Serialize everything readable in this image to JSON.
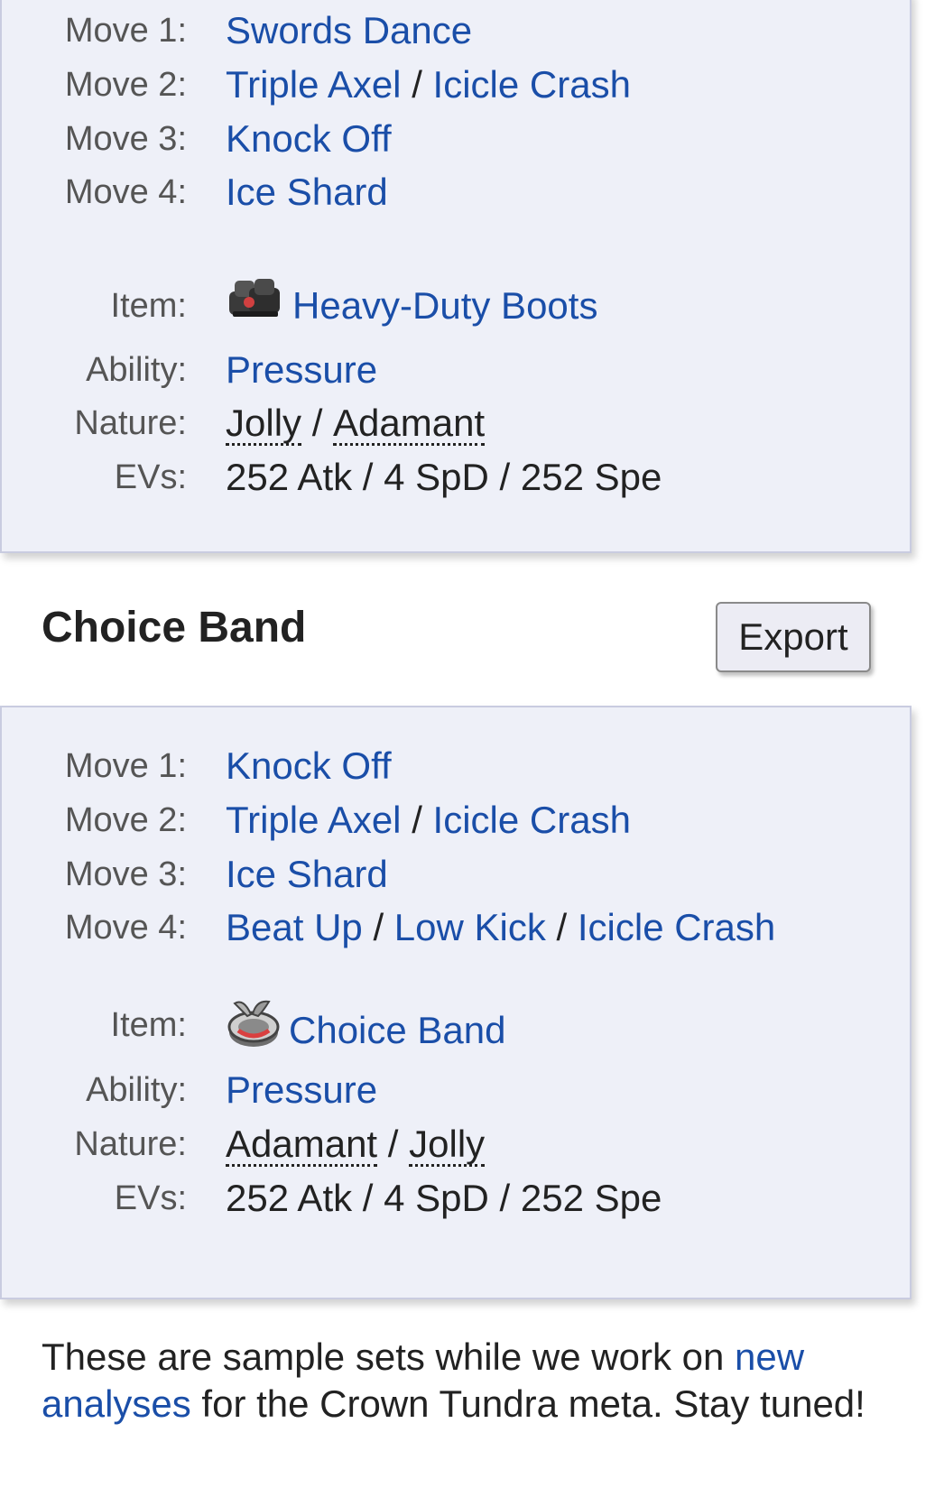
{
  "set1": {
    "moves": [
      {
        "label": "Move 1:",
        "options": [
          "Swords Dance"
        ]
      },
      {
        "label": "Move 2:",
        "options": [
          "Triple Axel",
          "Icicle Crash"
        ]
      },
      {
        "label": "Move 3:",
        "options": [
          "Knock Off"
        ]
      },
      {
        "label": "Move 4:",
        "options": [
          "Ice Shard"
        ]
      }
    ],
    "item_label": "Item:",
    "item": "Heavy-Duty Boots",
    "item_icon": "heavy-duty-boots-icon",
    "ability_label": "Ability:",
    "ability": "Pressure",
    "nature_label": "Nature:",
    "natures": [
      "Jolly",
      "Adamant"
    ],
    "evs_label": "EVs:",
    "evs": "252 Atk / 4 SpD / 252 Spe"
  },
  "set2": {
    "title": "Choice Band",
    "export_label": "Export",
    "moves": [
      {
        "label": "Move 1:",
        "options": [
          "Knock Off"
        ]
      },
      {
        "label": "Move 2:",
        "options": [
          "Triple Axel",
          "Icicle Crash"
        ]
      },
      {
        "label": "Move 3:",
        "options": [
          "Ice Shard"
        ]
      },
      {
        "label": "Move 4:",
        "options": [
          "Beat Up",
          "Low Kick",
          "Icicle Crash"
        ]
      }
    ],
    "item_label": "Item:",
    "item": "Choice Band",
    "item_icon": "choice-band-icon",
    "ability_label": "Ability:",
    "ability": "Pressure",
    "nature_label": "Nature:",
    "natures": [
      "Adamant",
      "Jolly"
    ],
    "evs_label": "EVs:",
    "evs": "252 Atk / 4 SpD / 252 Spe"
  },
  "footer": {
    "text_before": "These are sample sets while we work on ",
    "link": "new analyses",
    "text_after": " for the Crown Tundra meta. Stay tuned!"
  },
  "colors": {
    "link": "#1a4ea8",
    "card_bg": "#eef0f8",
    "card_border": "#c9cce0",
    "card_top_accent": "#8f92c8"
  },
  "separator": "/"
}
